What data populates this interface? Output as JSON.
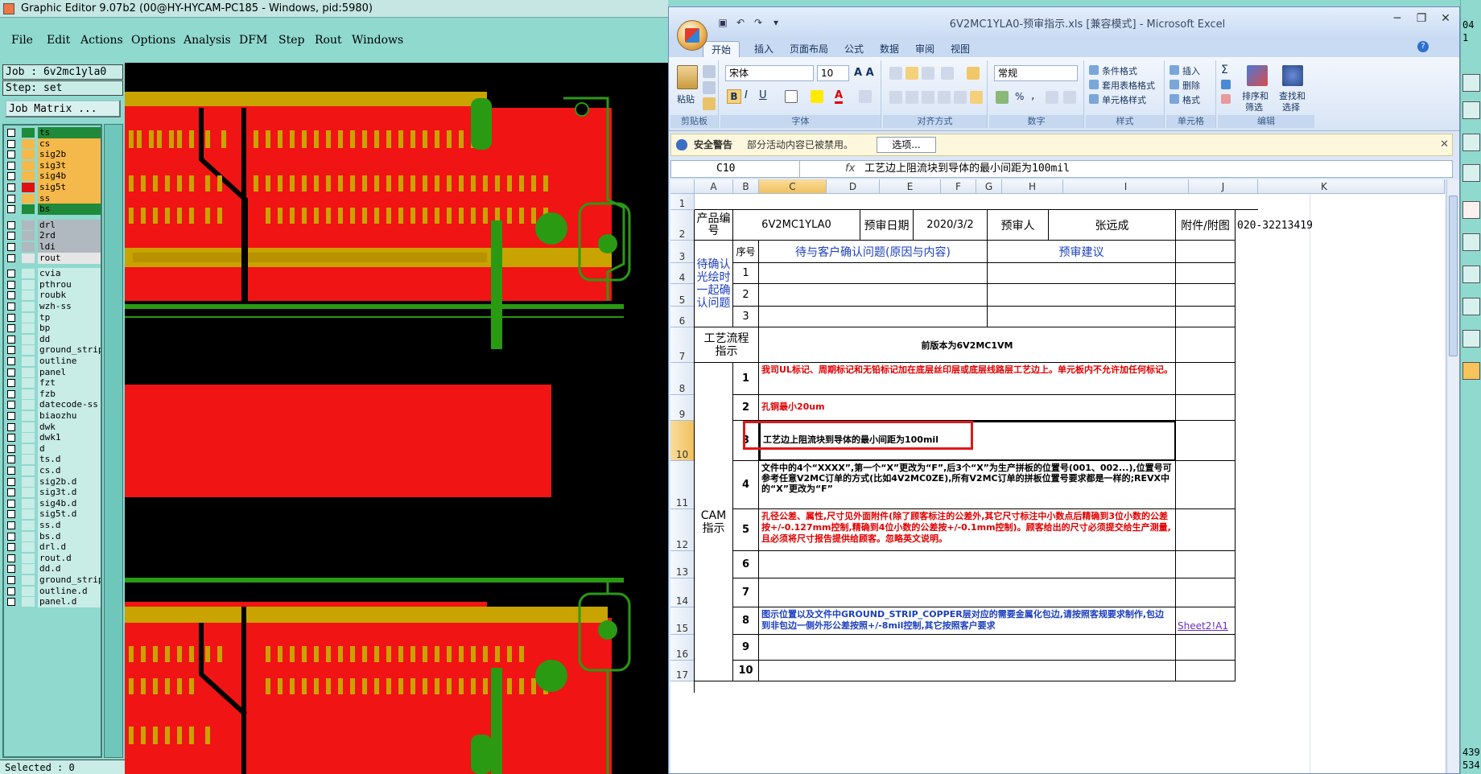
{
  "graphic_editor": {
    "title": "Graphic Editor 9.07b2 (00@HY-HYCAM-PC185 - Windows, pid:5980)",
    "menu": [
      "File",
      "Edit",
      "Actions",
      "Options",
      "Analysis",
      "DFM",
      "Step",
      "Rout",
      "Windows"
    ],
    "job_label": "Job : 6v2mc1yla0",
    "step_label": "Step: set",
    "job_matrix_button": "Job Matrix ...",
    "layers": [
      {
        "name": "ts",
        "color": "#1f8a3a",
        "swatch": "#1f8a3a"
      },
      {
        "name": "cs",
        "color": "#f5b84a",
        "swatch": "#f5b84a"
      },
      {
        "name": "sig2b",
        "color": "#f5b84a",
        "swatch": "#f5b84a"
      },
      {
        "name": "sig3t",
        "color": "#f5b84a",
        "swatch": "#f5b84a"
      },
      {
        "name": "sig4b",
        "color": "#f5b84a",
        "swatch": "#f5b84a"
      },
      {
        "name": "sig5t",
        "color": "#f5b84a",
        "swatch": "#e01010"
      },
      {
        "name": "ss",
        "color": "#f5b84a",
        "swatch": "#f5b84a"
      },
      {
        "name": "bs",
        "color": "#1f8a3a",
        "swatch": "#1f8a3a"
      },
      {
        "name": "drl",
        "color": "#b0b8c0",
        "swatch": "#b0b8c0"
      },
      {
        "name": "2rd",
        "color": "#b0b8c0",
        "swatch": "#b0b8c0"
      },
      {
        "name": "ldi",
        "color": "#b0b8c0",
        "swatch": "#b0b8c0"
      },
      {
        "name": "rout",
        "color": "#e6e6e6",
        "swatch": "#e6e6e6"
      },
      {
        "name": "cvia",
        "color": "#c8ece6",
        "swatch": "#c8ece6"
      },
      {
        "name": "pthrou",
        "color": "#c8ece6",
        "swatch": "#c8ece6"
      },
      {
        "name": "roubk",
        "color": "#c8ece6",
        "swatch": "#c8ece6"
      },
      {
        "name": "wzh-ss",
        "color": "#c8ece6",
        "swatch": "#c8ece6"
      },
      {
        "name": "tp",
        "color": "#c8ece6",
        "swatch": "#c8ece6"
      },
      {
        "name": "bp",
        "color": "#c8ece6",
        "swatch": "#c8ece6"
      },
      {
        "name": "dd",
        "color": "#c8ece6",
        "swatch": "#c8ece6"
      },
      {
        "name": "ground_strip",
        "color": "#c8ece6",
        "swatch": "#c8ece6"
      },
      {
        "name": "outline",
        "color": "#c8ece6",
        "swatch": "#c8ece6"
      },
      {
        "name": "panel",
        "color": "#c8ece6",
        "swatch": "#c8ece6"
      },
      {
        "name": "fzt",
        "color": "#c8ece6",
        "swatch": "#c8ece6"
      },
      {
        "name": "fzb",
        "color": "#c8ece6",
        "swatch": "#c8ece6"
      },
      {
        "name": "datecode-ss",
        "color": "#c8ece6",
        "swatch": "#c8ece6"
      },
      {
        "name": "biaozhu",
        "color": "#c8ece6",
        "swatch": "#c8ece6"
      },
      {
        "name": "dwk",
        "color": "#c8ece6",
        "swatch": "#c8ece6"
      },
      {
        "name": "dwk1",
        "color": "#c8ece6",
        "swatch": "#c8ece6"
      },
      {
        "name": "d",
        "color": "#c8ece6",
        "swatch": "#c8ece6"
      },
      {
        "name": "ts.d",
        "color": "#c8ece6",
        "swatch": "#c8ece6"
      },
      {
        "name": "cs.d",
        "color": "#c8ece6",
        "swatch": "#c8ece6"
      },
      {
        "name": "sig2b.d",
        "color": "#c8ece6",
        "swatch": "#c8ece6"
      },
      {
        "name": "sig3t.d",
        "color": "#c8ece6",
        "swatch": "#c8ece6"
      },
      {
        "name": "sig4b.d",
        "color": "#c8ece6",
        "swatch": "#c8ece6"
      },
      {
        "name": "sig5t.d",
        "color": "#c8ece6",
        "swatch": "#c8ece6"
      },
      {
        "name": "ss.d",
        "color": "#c8ece6",
        "swatch": "#c8ece6"
      },
      {
        "name": "bs.d",
        "color": "#c8ece6",
        "swatch": "#c8ece6"
      },
      {
        "name": "drl.d",
        "color": "#c8ece6",
        "swatch": "#c8ece6"
      },
      {
        "name": "rout.d",
        "color": "#c8ece6",
        "swatch": "#c8ece6"
      },
      {
        "name": "dd.d",
        "color": "#c8ece6",
        "swatch": "#c8ece6"
      },
      {
        "name": "ground_strip",
        "color": "#c8ece6",
        "swatch": "#c8ece6"
      },
      {
        "name": "outline.d",
        "color": "#c8ece6",
        "swatch": "#c8ece6"
      },
      {
        "name": "panel.d",
        "color": "#c8ece6",
        "swatch": "#c8ece6"
      }
    ],
    "selected_label": "Selected : 0",
    "right_numbers_top": [
      "04",
      "1"
    ],
    "right_numbers_bottom": [
      "439",
      "534"
    ]
  },
  "excel": {
    "window_title": "6V2MC1YLA0-预审指示.xls  [兼容模式] - Microsoft Excel",
    "tabs": [
      "开始",
      "插入",
      "页面布局",
      "公式",
      "数据",
      "审阅",
      "视图"
    ],
    "ribbon": {
      "clipboard": {
        "paste": "粘贴",
        "group": "剪贴板"
      },
      "font": {
        "name": "宋体",
        "size": "10",
        "group": "字体"
      },
      "alignment": {
        "group": "对齐方式"
      },
      "number": {
        "format": "常规",
        "group": "数字"
      },
      "styles": {
        "cond": "条件格式",
        "table": "套用表格格式",
        "cell": "单元格样式",
        "group": "样式"
      },
      "cells": {
        "insert": "插入",
        "delete": "删除",
        "format": "格式",
        "group": "单元格"
      },
      "editing": {
        "sort": "排序和",
        "sort2": "筛选",
        "find": "查找和",
        "find2": "选择",
        "group": "编辑"
      }
    },
    "security": {
      "title": "安全警告",
      "message": "部分活动内容已被禁用。",
      "options": "选项..."
    },
    "name_box": "C10",
    "fx": "fx",
    "formula": "工艺边上阻流块到导体的最小间距为100mil",
    "columns": [
      "A",
      "B",
      "C",
      "D",
      "E",
      "F",
      "G",
      "H",
      "I",
      "J",
      "K"
    ],
    "row_numbers": [
      "1",
      "2",
      "3",
      "4",
      "5",
      "6",
      "7",
      "8",
      "9",
      "10",
      "11",
      "12",
      "13",
      "14",
      "15",
      "16",
      "17"
    ],
    "sheet": {
      "product_no_label": "产品编号",
      "product_no": "6V2MC1YLA0",
      "review_date_label": "预审日期",
      "review_date": "2020/3/2",
      "reviewer_label": "预审人",
      "reviewer": "张远成",
      "attachment_label": "附件/附图",
      "phone": "020-32213419",
      "seq_label": "序号",
      "pending_header": "待与客户确认问题(原因与内容)",
      "suggestion_header": "预审建议",
      "pending_section": "待确认光绘时一起确认问题",
      "pending_nums": [
        "1",
        "2",
        "3"
      ],
      "process_label": "工艺流程指示",
      "process_text": "前版本为6V2MC1VM",
      "cam_label": "CAM指示",
      "cam_items": [
        {
          "n": "1",
          "text": "我司UL标记、周期标记和无铅标记加在底层丝印层或底层线路层工艺边上。单元板内不允许加任何标记。",
          "style": "red"
        },
        {
          "n": "2",
          "text": "孔铜最小20um",
          "style": "red"
        },
        {
          "n": "3",
          "text": "工艺边上阻流块到导体的最小间距为100mil",
          "style": "black"
        },
        {
          "n": "4",
          "text": "文件中的4个“XXXX”,第一个“X”更改为“F”,后3个“X”为生产拼板的位置号(001、002...),位置号可参考任意V2MC订单的方式(比如4V2MC0ZE),所有V2MC订单的拼板位置号要求都是一样的;REVX中的“X”更改为“F”",
          "style": "mixed"
        },
        {
          "n": "5",
          "text": "孔径公差、属性,尺寸见外面附件(除了顾客标注的公差外,其它尺寸标注中小数点后精确到3位小数的公差按+/-0.127mm控制,精确到4位小数的公差按+/-0.1mm控制)。顾客给出的尺寸必须提交给生产测量,且必须将尺寸报告提供给顾客。忽略英文说明。",
          "style": "red"
        },
        {
          "n": "6",
          "text": "",
          "style": "black"
        },
        {
          "n": "7",
          "text": "",
          "style": "black"
        },
        {
          "n": "8",
          "text": "图示位置以及文件中GROUND_STRIP_COPPER层对应的需要金属化包边,请按照客规要求制作,包边到非包边一侧外形公差按照+/-8mil控制,其它按照客户要求",
          "style": "blue"
        },
        {
          "n": "9",
          "text": "",
          "style": "black"
        },
        {
          "n": "10",
          "text": "",
          "style": "black"
        }
      ],
      "link": "Sheet2!A1"
    }
  },
  "colors": {
    "pcb_red": "#f01414",
    "pcb_gold": "#c9a300",
    "pcb_green": "#2a9a12",
    "highlight_box": "#e01818"
  }
}
